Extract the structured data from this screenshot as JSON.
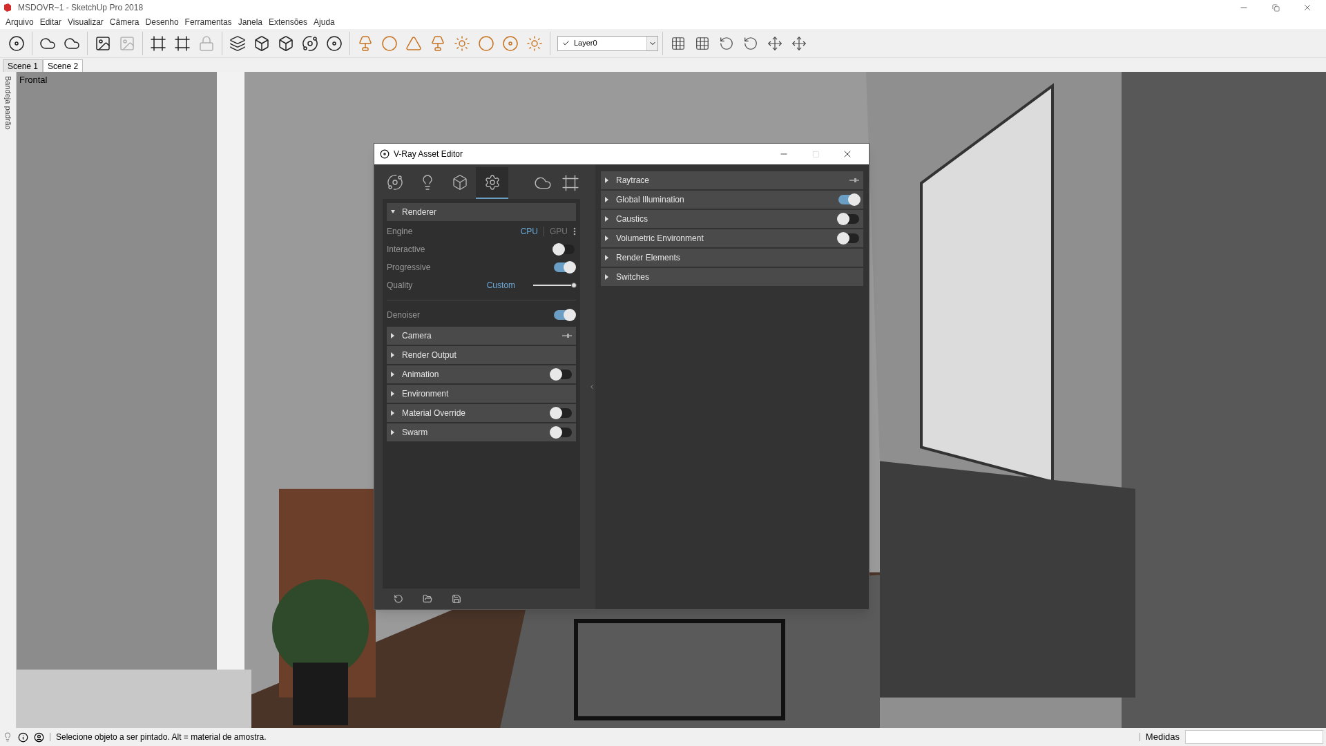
{
  "window": {
    "title": "MSDOVR~1 - SketchUp Pro 2018"
  },
  "menu": [
    "Arquivo",
    "Editar",
    "Visualizar",
    "Câmera",
    "Desenho",
    "Ferramentas",
    "Janela",
    "Extensões",
    "Ajuda"
  ],
  "toolbar": {
    "groups": [
      [
        {
          "disabled": false
        }
      ],
      [
        {
          "disabled": false
        },
        {
          "disabled": false
        }
      ],
      [
        {
          "disabled": false
        },
        {
          "disabled": true
        }
      ],
      [
        {
          "disabled": false
        },
        {
          "disabled": false
        },
        {
          "disabled": true
        }
      ],
      [
        {
          "disabled": false
        },
        {
          "disabled": false
        },
        {
          "disabled": false
        },
        {
          "disabled": false
        },
        {
          "disabled": false
        }
      ],
      [
        {
          "disabled": false
        },
        {
          "disabled": false
        },
        {
          "disabled": false
        },
        {
          "disabled": false
        },
        {
          "disabled": false
        },
        {
          "disabled": false
        },
        {
          "disabled": false
        },
        {
          "disabled": false
        }
      ]
    ],
    "layer": "Layer0"
  },
  "scene_tabs": [
    {
      "label": "Scene 1",
      "selected": false
    },
    {
      "label": "Scene 2",
      "selected": true
    }
  ],
  "tray_label": "Bandeja padrão",
  "viewport": {
    "label": "Frontal"
  },
  "asset_editor": {
    "title": "V-Ray Asset Editor",
    "category_tabs": [
      {
        "selected": false
      },
      {
        "selected": false
      },
      {
        "selected": false
      },
      {
        "selected": true
      }
    ],
    "renderer": {
      "title": "Renderer",
      "expanded": true,
      "engine": {
        "label": "Engine",
        "options": [
          {
            "label": "CPU",
            "selected": true
          },
          {
            "label": "GPU",
            "selected": false
          }
        ]
      },
      "interactive": {
        "label": "Interactive",
        "on": false
      },
      "progressive": {
        "label": "Progressive",
        "on": true
      },
      "quality": {
        "label": "Quality",
        "value": "Custom",
        "level": 0.95
      },
      "denoiser": {
        "label": "Denoiser",
        "on": true
      }
    },
    "left_sections": [
      {
        "title": "Camera",
        "kind": "settings"
      },
      {
        "title": "Render Output",
        "kind": "plain"
      },
      {
        "title": "Animation",
        "kind": "toggle",
        "on": false
      },
      {
        "title": "Environment",
        "kind": "plain"
      },
      {
        "title": "Material Override",
        "kind": "toggle",
        "on": false
      },
      {
        "title": "Swarm",
        "kind": "toggle",
        "on": false
      }
    ],
    "right_sections": [
      {
        "title": "Raytrace",
        "kind": "settings"
      },
      {
        "title": "Global Illumination",
        "kind": "toggle",
        "on": true
      },
      {
        "title": "Caustics",
        "kind": "toggle",
        "on": false
      },
      {
        "title": "Volumetric Environment",
        "kind": "toggle",
        "on": false
      },
      {
        "title": "Render Elements",
        "kind": "plain"
      },
      {
        "title": "Switches",
        "kind": "plain"
      }
    ]
  },
  "status_bar": {
    "message": "Selecione objeto a ser pintado. Alt = material de amostra.",
    "measure_label": "Medidas"
  }
}
